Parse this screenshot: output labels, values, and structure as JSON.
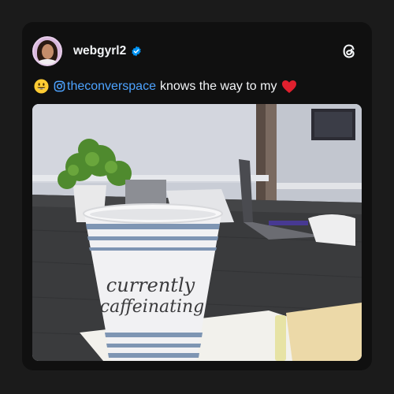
{
  "post": {
    "username": "webgyrl2",
    "verified": true,
    "caption": {
      "emoji": "smiley-face-emoji",
      "mention_icon": "instagram-icon",
      "mention": "theconverspace",
      "text": "knows the way to my",
      "trailing_emoji": "red-heart-emoji"
    },
    "photo": {
      "cup_text_line1": "currently",
      "cup_text_line2": "caffeinating"
    }
  },
  "colors": {
    "background": "#1b1b1b",
    "card": "#101010",
    "mention": "#4da3ff",
    "verified_badge": "#0095f6"
  }
}
